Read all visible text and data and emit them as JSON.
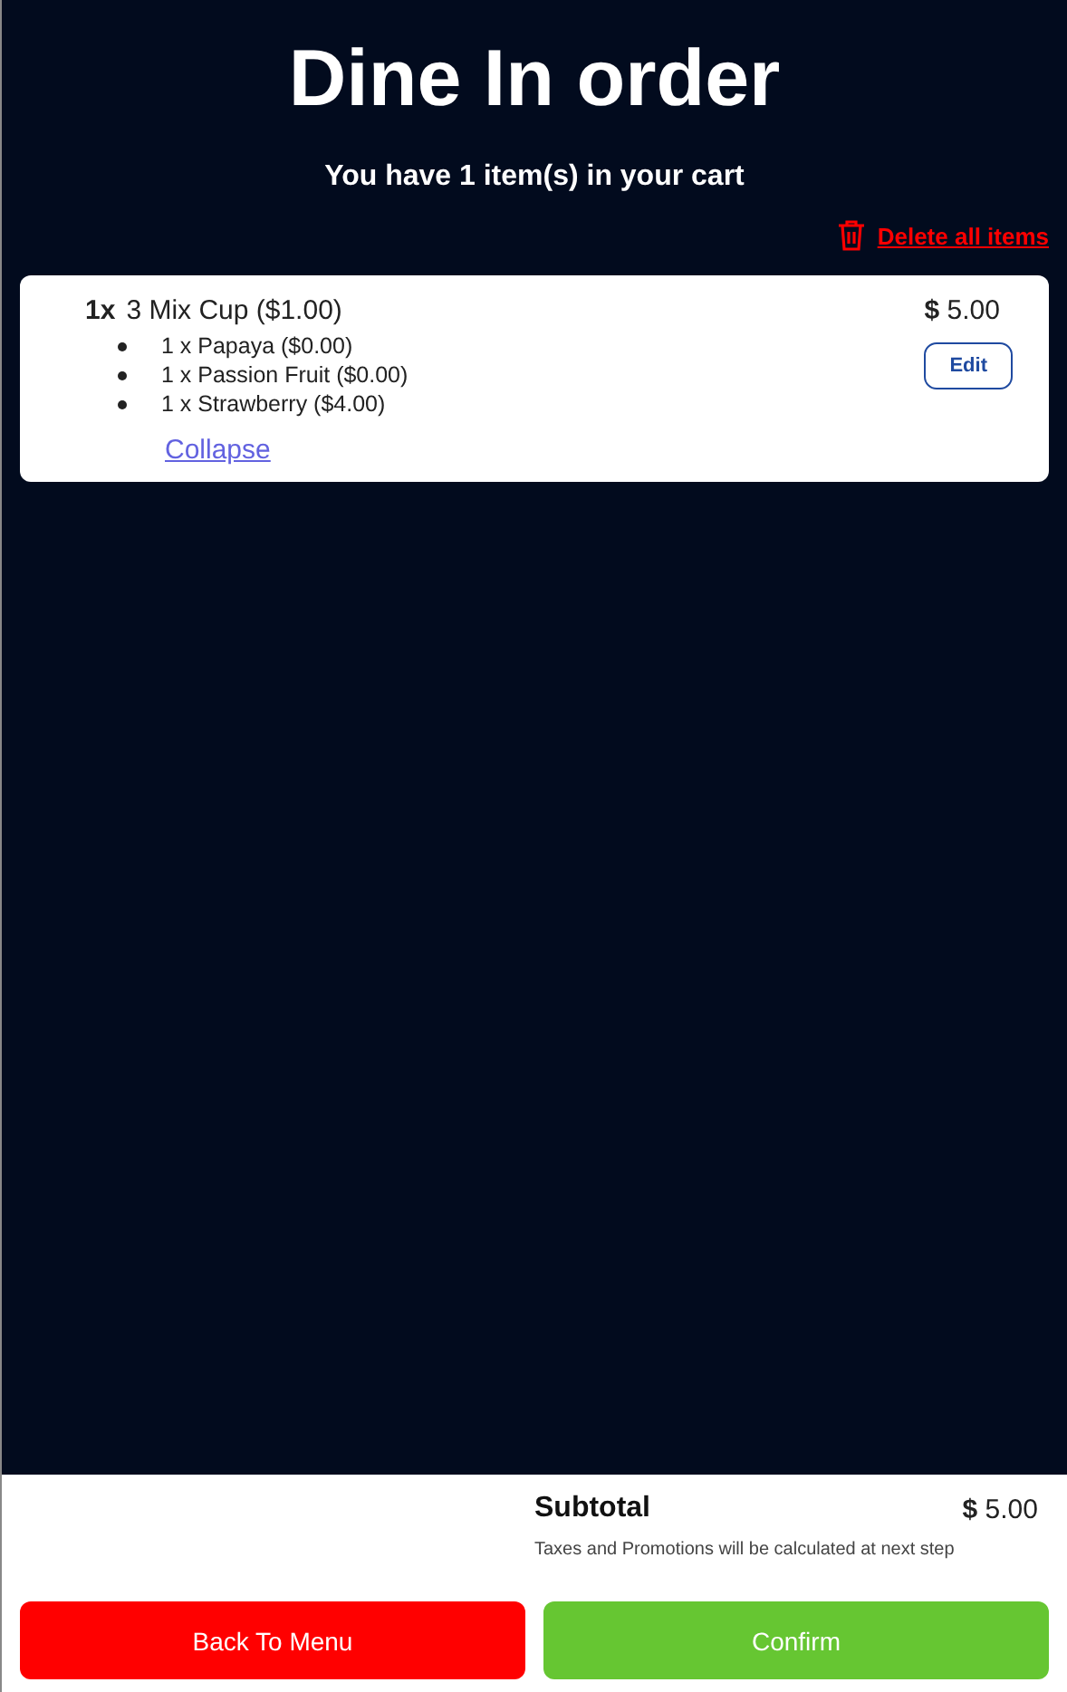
{
  "title": "Dine In order",
  "cart_summary": "You have 1 item(s) in your cart",
  "delete_all": "Delete all items",
  "cart_items": [
    {
      "quantity": "1x",
      "name": "3 Mix Cup ($1.00)",
      "price": "**$** 5.00",
      "edit": "Edit",
      "options": [
        "1 x Papaya ($0.00)",
        "1 x Passion Fruit ($0.00)",
        "1 x Strawberry ($4.00)"
      ],
      "toggle": "Collapse"
    }
  ],
  "subtotal": {
    "label": "Subtotal",
    "value": "**$** 5.00",
    "note": "Taxes and Promotions will be calculated at next step"
  },
  "buttons": [
    {
      "label": "Back To Menu",
      "kind": "back"
    },
    {
      "label": "Confirm",
      "kind": "confirm"
    }
  ]
}
